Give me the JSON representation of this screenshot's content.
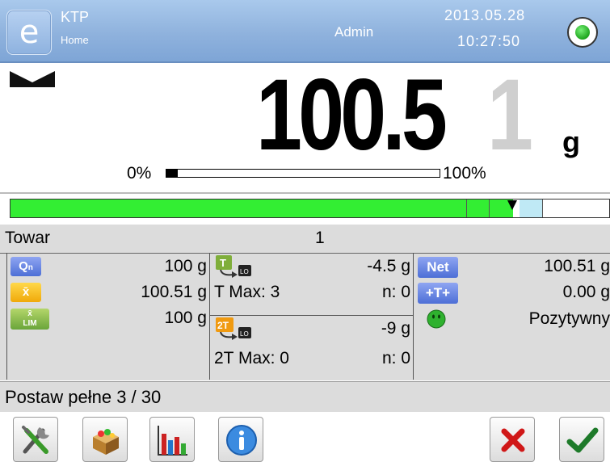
{
  "header": {
    "title": "KTP",
    "subtitle": "Home",
    "user": "Admin",
    "date": "2013.05.28",
    "time": "10:27:50",
    "logo_icon": "e-logo-icon",
    "status_icon": "green-status-icon"
  },
  "weighing": {
    "value_main": "100.5",
    "value_last_digit": "1",
    "unit": "g",
    "range_min_label": "0%",
    "range_max_label": "100%",
    "range_fill_fraction": 0.04,
    "stability_icon": "stable-indicator-icon"
  },
  "checkweigher": {
    "fill_fraction": 0.84,
    "colors": {
      "fill": "#33ee33",
      "light": "#bfe9f5"
    }
  },
  "product": {
    "label": "Towar",
    "value": "1"
  },
  "info": {
    "col1": [
      {
        "icon": "qn-icon",
        "icon_text": "Qn",
        "value": "100 g"
      },
      {
        "icon": "mean-x-icon",
        "icon_text": "x̄",
        "value": "100.51 g"
      },
      {
        "icon": "mean-lim-icon",
        "icon_text": "x̄ LIM",
        "value": "100 g"
      }
    ],
    "col2": {
      "t_icon": "tolerance-t-icon",
      "t_value": "-4.5 g",
      "t_max_label": "T Max: 3",
      "t_n_label": "n: 0",
      "t2_icon": "tolerance-2t-icon",
      "t2_value": "-9 g",
      "t2_max_label": "2T Max: 0",
      "t2_n_label": "n: 0"
    },
    "col3": [
      {
        "icon": "net-icon",
        "icon_text": "Net",
        "value": "100.51 g"
      },
      {
        "icon": "tare-icon",
        "icon_text": "+T+",
        "value": "0.00 g"
      },
      {
        "icon": "smiley-positive-icon",
        "icon_text": "",
        "value": "Pozytywny"
      }
    ]
  },
  "status": {
    "text": "Postaw pełne 3 / 30"
  },
  "toolbar": {
    "buttons": [
      {
        "icon": "tools-settings-icon"
      },
      {
        "icon": "product-database-icon"
      },
      {
        "icon": "statistics-chart-icon"
      },
      {
        "icon": "info-icon"
      },
      {
        "icon": "cancel-x-icon"
      },
      {
        "icon": "confirm-check-icon"
      }
    ]
  }
}
